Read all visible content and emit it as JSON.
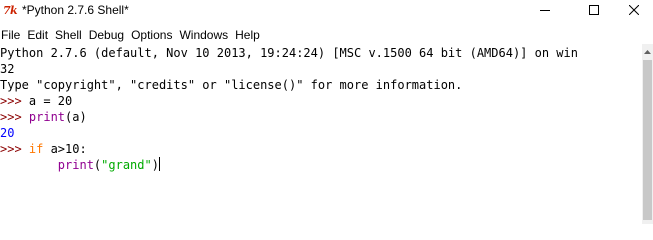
{
  "window": {
    "title": "*Python 2.7.6 Shell*"
  },
  "menu": {
    "items": [
      "File",
      "Edit",
      "Shell",
      "Debug",
      "Options",
      "Windows",
      "Help"
    ]
  },
  "shell": {
    "banner_line1": "Python 2.7.6 (default, Nov 10 2013, 19:24:24) [MSC v.1500 64 bit (AMD64)] on win",
    "banner_line2": "32",
    "banner_line3": "Type \"copyright\", \"credits\" or \"license()\" for more information.",
    "prompt": ">>> ",
    "cmd1": "a = 20",
    "cmd2_func": "print",
    "cmd2_args": "(a)",
    "output1": "20",
    "cmd3_keyword": "if",
    "cmd3_rest": " a>10:",
    "cmd4_indent": "        ",
    "cmd4_func": "print",
    "cmd4_open": "(",
    "cmd4_string": "\"grand\"",
    "cmd4_close": ")"
  },
  "colors": {
    "prompt": "#8b0000",
    "builtin": "#900090",
    "keyword": "#ff7700",
    "string": "#00aa00",
    "output": "#0000ff"
  },
  "icons": {
    "app": "python-idle-icon",
    "minimize": "minimize-icon",
    "maximize": "maximize-icon",
    "close": "close-icon",
    "scroll_up": "scroll-up-arrow-icon"
  }
}
